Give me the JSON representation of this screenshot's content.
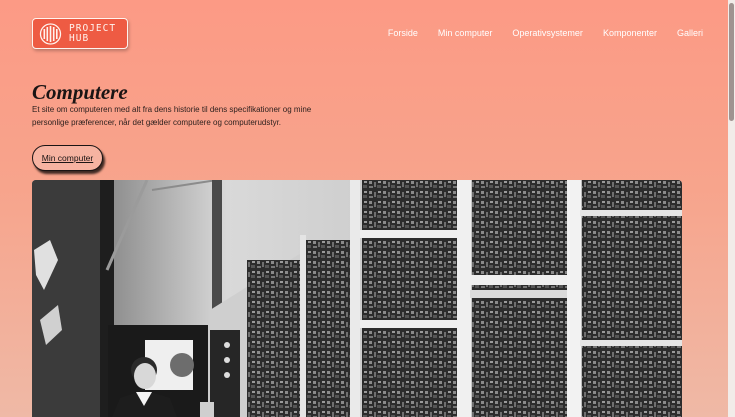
{
  "brand": {
    "logo_text_line1": "PROJECT",
    "logo_text_line2": "HUB",
    "logo_icon": "equalizer-bars-icon",
    "accent": "#ee5b43"
  },
  "nav": {
    "items": [
      {
        "label": "Forside"
      },
      {
        "label": "Min computer"
      },
      {
        "label": "Operativsystemer"
      },
      {
        "label": "Komponenter"
      },
      {
        "label": "Galleri"
      }
    ]
  },
  "hero": {
    "title": "Computere",
    "description": "Et site om computeren med alt fra dens historie til dens specifikationer og mine personlige præferencer, når det gælder computere og computerudstyr.",
    "button_label": "Min computer",
    "image_subject": "black-and-white photo of early computer racks with operator"
  },
  "colors": {
    "background_top": "#fc9a85",
    "background_bottom": "#efb9a6",
    "text_dark": "#1a1414"
  }
}
